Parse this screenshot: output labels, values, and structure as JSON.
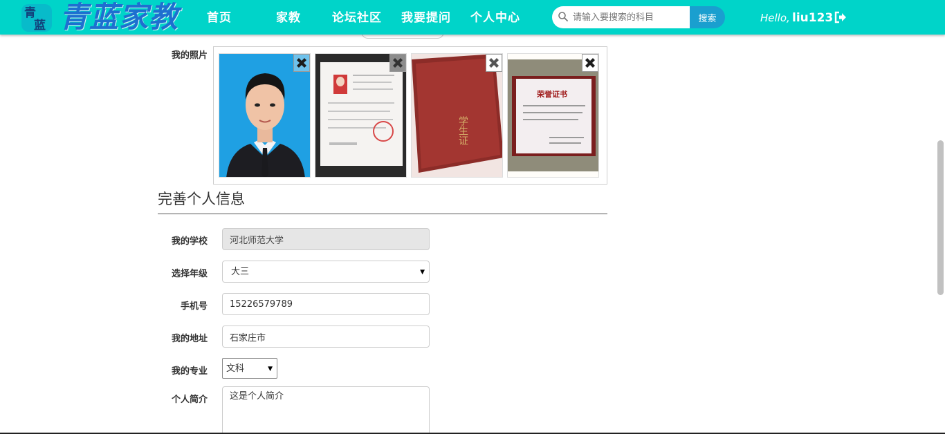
{
  "brand": {
    "logo_text": "青蓝家教",
    "seal_text": "青蓝"
  },
  "nav": {
    "items": [
      {
        "label": "首页"
      },
      {
        "label": "家教"
      },
      {
        "label": "论坛社区"
      },
      {
        "label": "我要提问"
      },
      {
        "label": "个人中心"
      }
    ]
  },
  "search": {
    "placeholder": "请输入要搜索的科目",
    "button_label": "搜索"
  },
  "user": {
    "greeting": "Hello,",
    "username": "liu123",
    "logout_icon": "sign-out-icon"
  },
  "photos": {
    "label": "我的照片",
    "items": [
      {
        "name": "portrait-photo",
        "delete_icon": "close-icon"
      },
      {
        "name": "id-certificate-photo",
        "delete_icon": "close-icon"
      },
      {
        "name": "student-card-cover-photo",
        "delete_icon": "close-icon",
        "cover_text": "学生证"
      },
      {
        "name": "honor-certificate-photo",
        "delete_icon": "close-icon",
        "cert_title": "荣誉证书"
      }
    ]
  },
  "section": {
    "title": "完善个人信息"
  },
  "form": {
    "school": {
      "label": "我的学校",
      "value": "河北师范大学"
    },
    "grade": {
      "label": "选择年级",
      "value": "大三"
    },
    "phone": {
      "label": "手机号",
      "value": "15226579789"
    },
    "address": {
      "label": "我的地址",
      "value": "石家庄市"
    },
    "major": {
      "label": "我的专业",
      "value": "文科"
    },
    "bio": {
      "label": "个人简介",
      "value": "这是个人简介"
    }
  },
  "colors": {
    "navbar": "#00d4c9",
    "search_button": "#1a9fcf",
    "logo": "#1e6fd0"
  }
}
